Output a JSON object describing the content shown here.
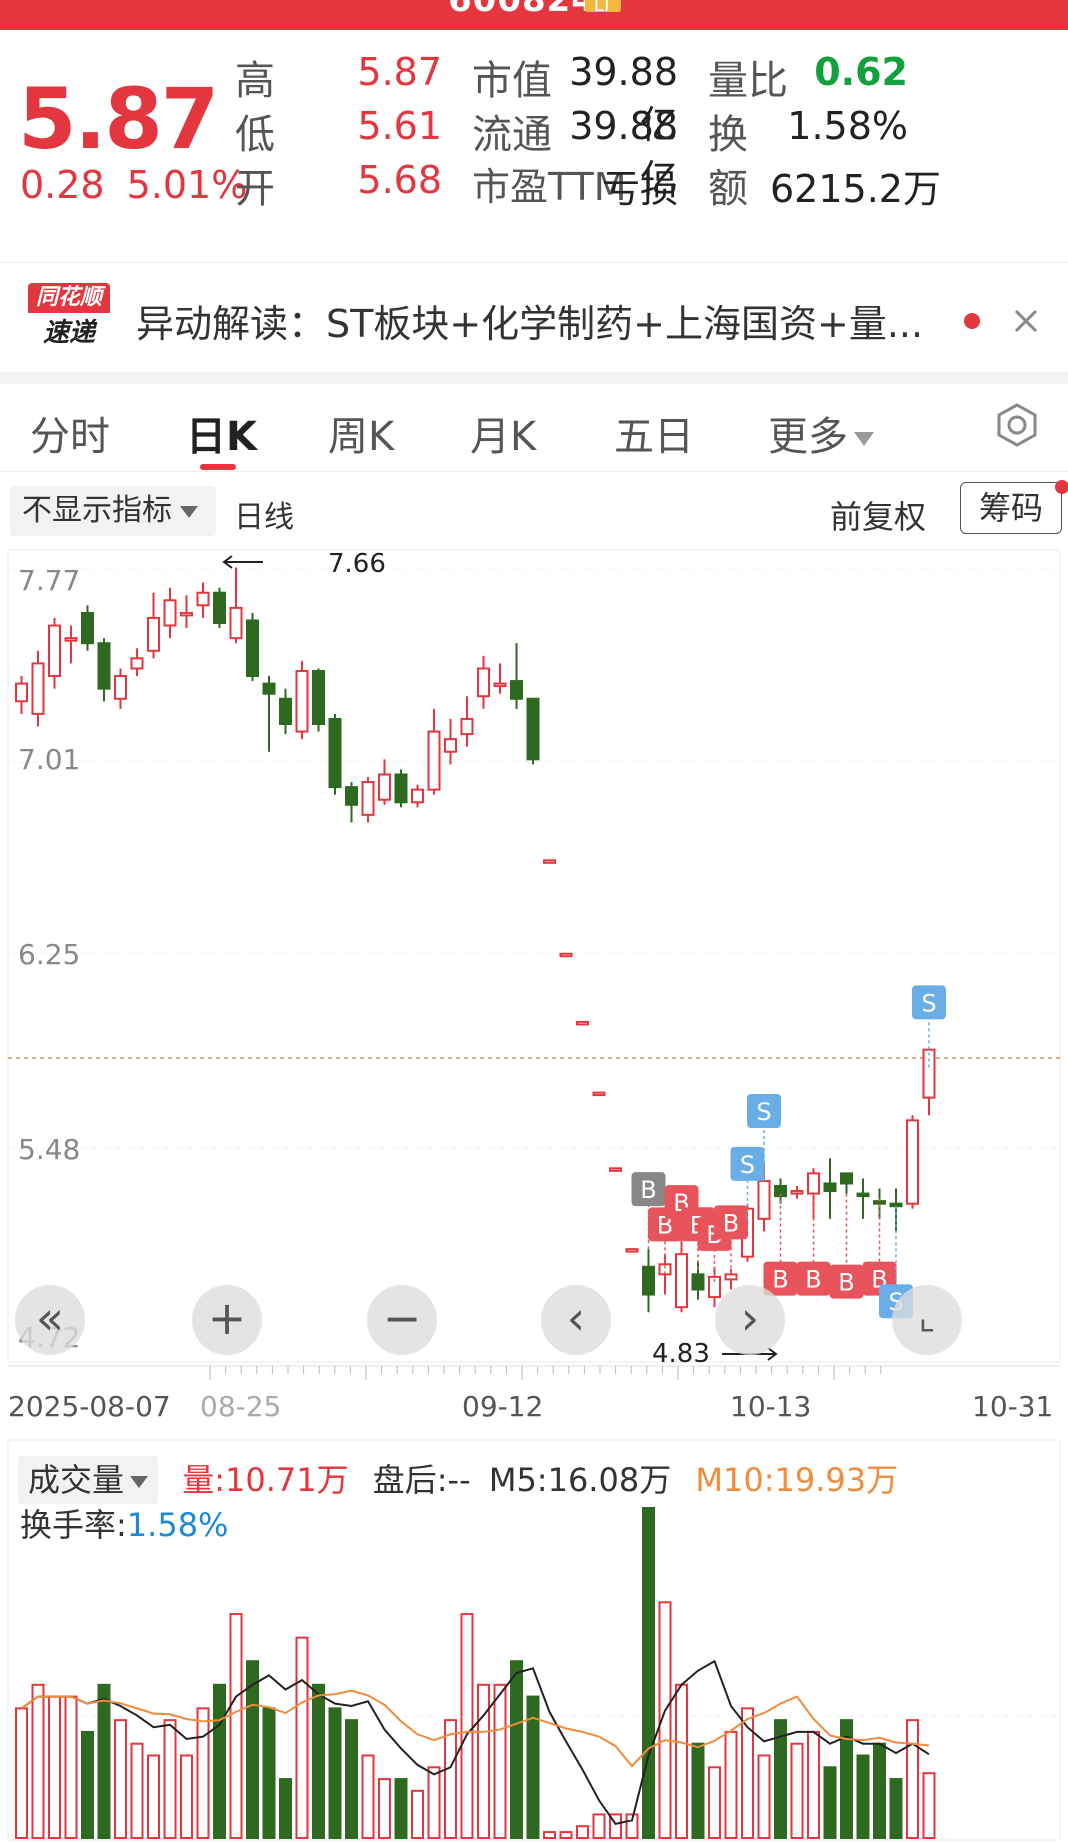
{
  "titlebar": {
    "code": "600824",
    "badge": "LT"
  },
  "quote": {
    "price": "5.87",
    "change": "0.28",
    "change_pct": "5.01%",
    "high_label": "高",
    "high": "5.87",
    "low_label": "低",
    "low": "5.61",
    "open_label": "开",
    "open": "5.68",
    "mktcap_label": "市值",
    "mktcap": "39.88亿",
    "float_label": "流通",
    "float": "39.88亿",
    "pe_label": "市盈TTM",
    "pe": "亏损",
    "volratio_label": "量比",
    "volratio": "0.62",
    "turnover_label": "换",
    "turnover": "1.58%",
    "amount_label": "额",
    "amount": "6215.2万"
  },
  "news": {
    "logo_top": "同花顺",
    "logo_bottom": "速递",
    "text": "异动解读：ST板块+化学制药+上海国资+量..."
  },
  "tabs": [
    "分时",
    "日K",
    "周K",
    "月K",
    "五日"
  ],
  "tab_more": "更多",
  "controls": {
    "indicator": "不显示指标",
    "line_type": "日线",
    "adjust": "前复权",
    "chips": "筹码"
  },
  "chart": {
    "y_ticks": [
      "7.77",
      "7.01",
      "6.25",
      "5.48",
      "4.72"
    ],
    "x_ticks": [
      "2025-08-07",
      "08-25",
      "09-12",
      "10-13",
      "10-31"
    ],
    "max_label": "7.66",
    "min_label": "4.83"
  },
  "volume": {
    "selector": "成交量",
    "vol": "量:10.71万",
    "after": "盘后:--",
    "m5": "M5:16.08万",
    "m10": "M10:19.93万",
    "turnover_label": "换手率:",
    "turnover_val": "1.58%"
  },
  "colors": {
    "up": "#e3363e",
    "down": "#2d6a1f",
    "ma5": "#222222",
    "ma10": "#f08c3c",
    "sell": "#6aaee8"
  },
  "chart_data": {
    "type": "candlestick",
    "candles": [
      [
        7.25,
        7.32,
        7.2,
        7.35
      ],
      [
        7.2,
        7.4,
        7.15,
        7.45
      ],
      [
        7.35,
        7.55,
        7.3,
        7.58
      ],
      [
        7.5,
        7.5,
        7.4,
        7.55
      ],
      [
        7.6,
        7.48,
        7.45,
        7.63
      ],
      [
        7.48,
        7.3,
        7.25,
        7.5
      ],
      [
        7.26,
        7.35,
        7.22,
        7.38
      ],
      [
        7.38,
        7.42,
        7.35,
        7.46
      ],
      [
        7.45,
        7.58,
        7.42,
        7.68
      ],
      [
        7.55,
        7.65,
        7.5,
        7.7
      ],
      [
        7.6,
        7.6,
        7.54,
        7.67
      ],
      [
        7.63,
        7.68,
        7.58,
        7.72
      ],
      [
        7.68,
        7.56,
        7.54,
        7.7
      ],
      [
        7.5,
        7.62,
        7.48,
        7.78
      ],
      [
        7.57,
        7.35,
        7.33,
        7.6
      ],
      [
        7.32,
        7.28,
        7.05,
        7.35
      ],
      [
        7.26,
        7.16,
        7.12,
        7.3
      ],
      [
        7.13,
        7.37,
        7.1,
        7.41
      ],
      [
        7.37,
        7.16,
        7.13,
        7.38
      ],
      [
        7.18,
        6.91,
        6.88,
        7.2
      ],
      [
        6.91,
        6.84,
        6.77,
        6.93
      ],
      [
        6.8,
        6.93,
        6.77,
        6.95
      ],
      [
        6.86,
        6.96,
        6.84,
        7.02
      ],
      [
        6.96,
        6.85,
        6.83,
        6.98
      ],
      [
        6.85,
        6.9,
        6.83,
        6.92
      ],
      [
        6.9,
        7.13,
        6.88,
        7.22
      ],
      [
        7.05,
        7.1,
        7.0,
        7.18
      ],
      [
        7.12,
        7.18,
        7.07,
        7.27
      ],
      [
        7.27,
        7.38,
        7.22,
        7.43
      ],
      [
        7.32,
        7.32,
        7.28,
        7.4
      ],
      [
        7.33,
        7.26,
        7.22,
        7.48
      ],
      [
        7.26,
        7.02,
        7.0,
        7.26
      ],
      [
        6.62,
        6.62,
        6.62,
        6.62
      ],
      [
        6.25,
        6.25,
        6.25,
        6.25
      ],
      [
        5.98,
        5.98,
        5.98,
        5.98
      ],
      [
        5.7,
        5.7,
        5.7,
        5.7
      ],
      [
        5.4,
        5.4,
        5.4,
        5.4
      ],
      [
        5.08,
        5.08,
        5.08,
        5.08
      ],
      [
        5.01,
        4.9,
        4.83,
        5.08
      ],
      [
        4.98,
        5.02,
        4.9,
        5.06
      ],
      [
        4.85,
        5.06,
        4.83,
        5.13
      ],
      [
        4.98,
        4.92,
        4.88,
        5.03
      ],
      [
        4.89,
        4.97,
        4.85,
        5.01
      ],
      [
        4.96,
        4.98,
        4.92,
        5.0
      ],
      [
        5.05,
        5.24,
        5.03,
        5.26
      ],
      [
        5.2,
        5.35,
        5.15,
        5.42
      ],
      [
        5.33,
        5.29,
        5.26,
        5.36
      ],
      [
        5.3,
        5.31,
        5.28,
        5.33
      ],
      [
        5.3,
        5.38,
        5.2,
        5.4
      ],
      [
        5.34,
        5.31,
        5.2,
        5.44
      ],
      [
        5.38,
        5.34,
        5.3,
        5.38
      ],
      [
        5.3,
        5.29,
        5.2,
        5.36
      ],
      [
        5.27,
        5.26,
        5.2,
        5.32
      ],
      [
        5.26,
        5.25,
        5.15,
        5.32
      ],
      [
        5.26,
        5.59,
        5.24,
        5.61
      ],
      [
        5.68,
        5.87,
        5.61,
        5.87
      ]
    ],
    "volume": [
      22,
      26,
      24,
      24,
      18,
      26,
      20,
      16,
      14,
      20,
      14,
      22,
      26,
      38,
      30,
      22,
      10,
      34,
      26,
      22,
      20,
      14,
      10,
      10,
      8,
      12,
      20,
      38,
      26,
      26,
      30,
      24,
      1,
      1,
      2,
      4,
      4,
      4,
      56,
      40,
      26,
      16,
      12,
      18,
      22,
      14,
      20,
      16,
      18,
      12,
      20,
      14,
      16,
      10,
      20,
      11
    ],
    "ylim": [
      4.72,
      7.77
    ],
    "x_labels": [
      "2025-08-07",
      "08-25",
      "09-12",
      "10-13",
      "10-31"
    ]
  }
}
